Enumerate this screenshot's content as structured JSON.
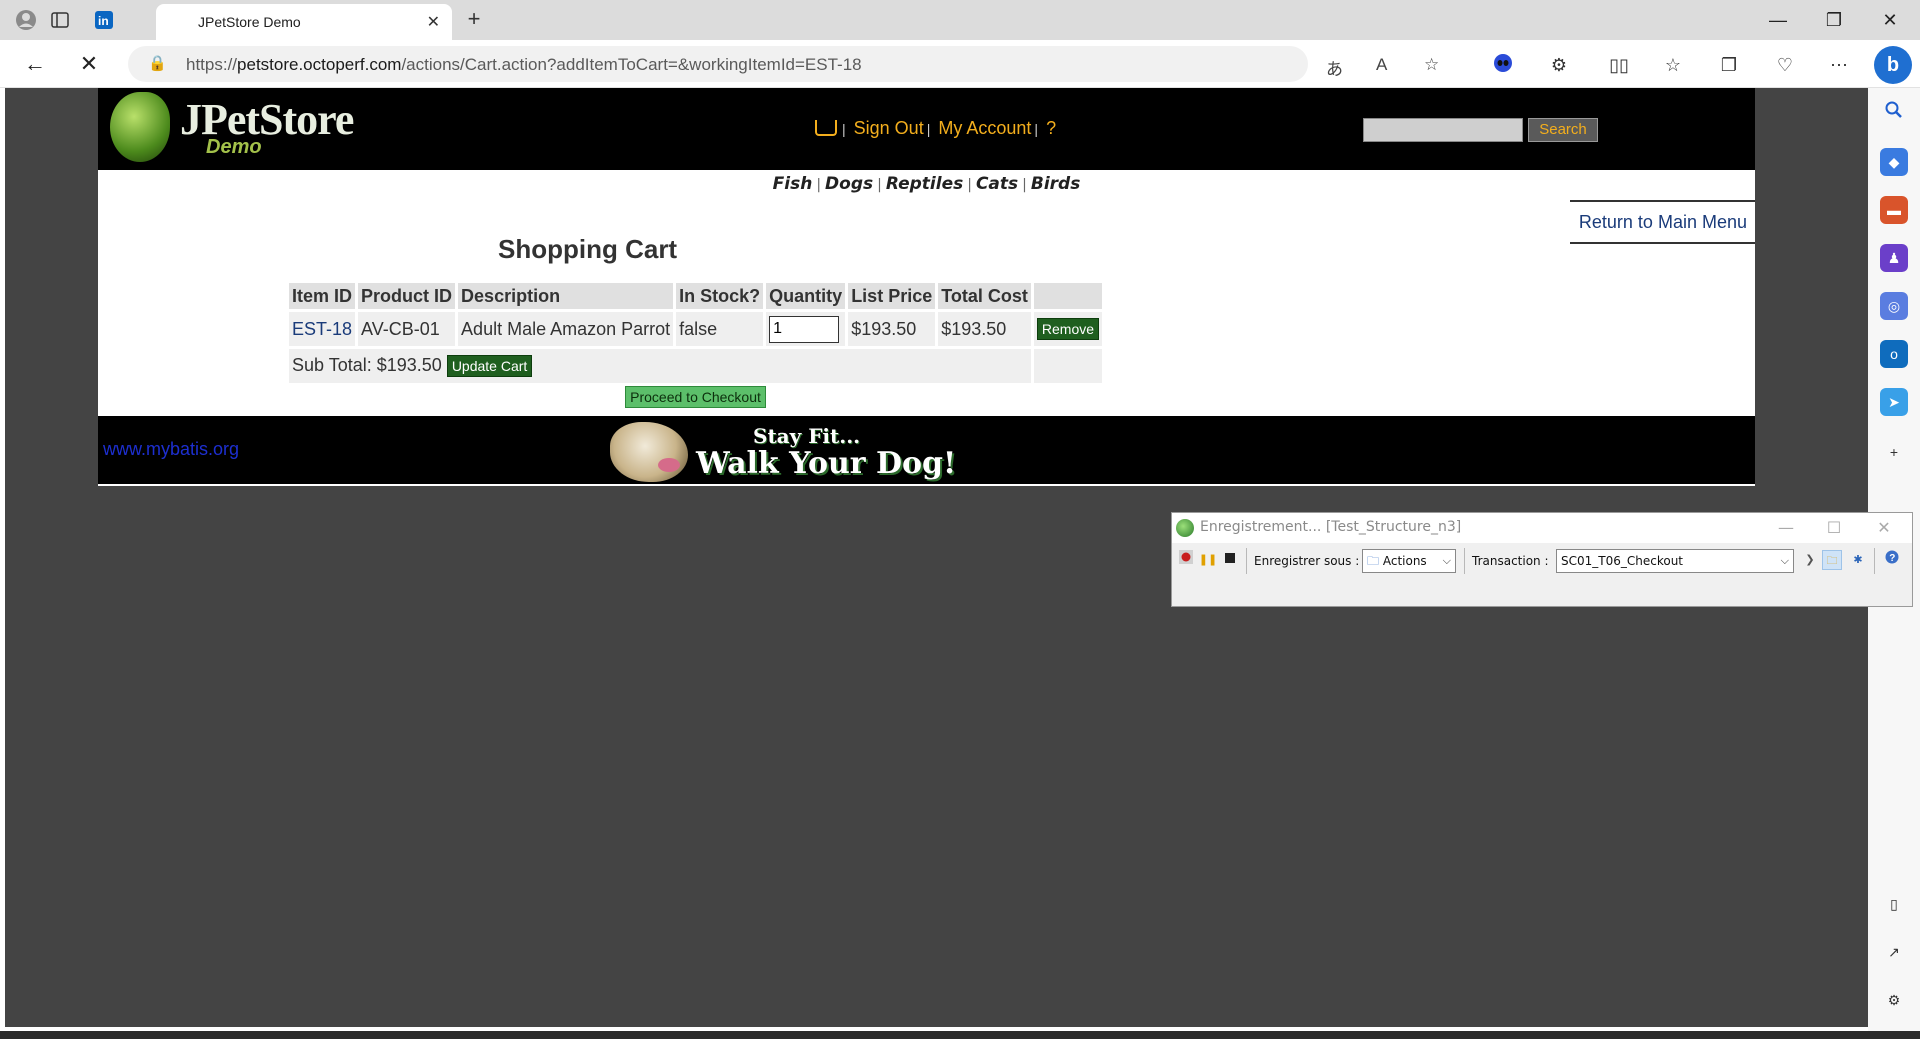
{
  "browser": {
    "tab_title": "JPetStore Demo",
    "url_prefix": "https://",
    "url_host": "petstore.octoperf.com",
    "url_path": "/actions/Cart.action?addItemToCart=&workingItemId=EST-18"
  },
  "site": {
    "logo_name": "JPetStore",
    "logo_demo": "Demo",
    "menu": {
      "sign_out": "Sign Out",
      "my_account": "My Account",
      "help": "?"
    },
    "search_button": "Search",
    "quicklinks": [
      "Fish",
      "Dogs",
      "Reptiles",
      "Cats",
      "Birds"
    ],
    "return_link": "Return to Main Menu",
    "cart_title": "Shopping Cart",
    "cart": {
      "headers": [
        "Item ID",
        "Product ID",
        "Description",
        "In Stock?",
        "Quantity",
        "List Price",
        "Total Cost"
      ],
      "row": {
        "item_id": "EST-18",
        "product_id": "AV-CB-01",
        "description": "Adult Male Amazon Parrot",
        "in_stock": "false",
        "quantity": "1",
        "list_price": "$193.50",
        "total_cost": "$193.50",
        "remove": "Remove"
      },
      "subtotal": "Sub Total: $193.50",
      "update_cart": "Update Cart",
      "checkout": "Proceed to Checkout"
    },
    "footer_link": "www.mybatis.org",
    "banner_line1": "Stay Fit...",
    "banner_line2": "Walk Your Dog!"
  },
  "recorder": {
    "title": "Enregistrement... [Test_Structure_n3]",
    "save_as_label": "Enregistrer sous :",
    "save_as_value": "Actions",
    "transaction_label": "Transaction :",
    "transaction_value": "SC01_T06_Checkout"
  }
}
